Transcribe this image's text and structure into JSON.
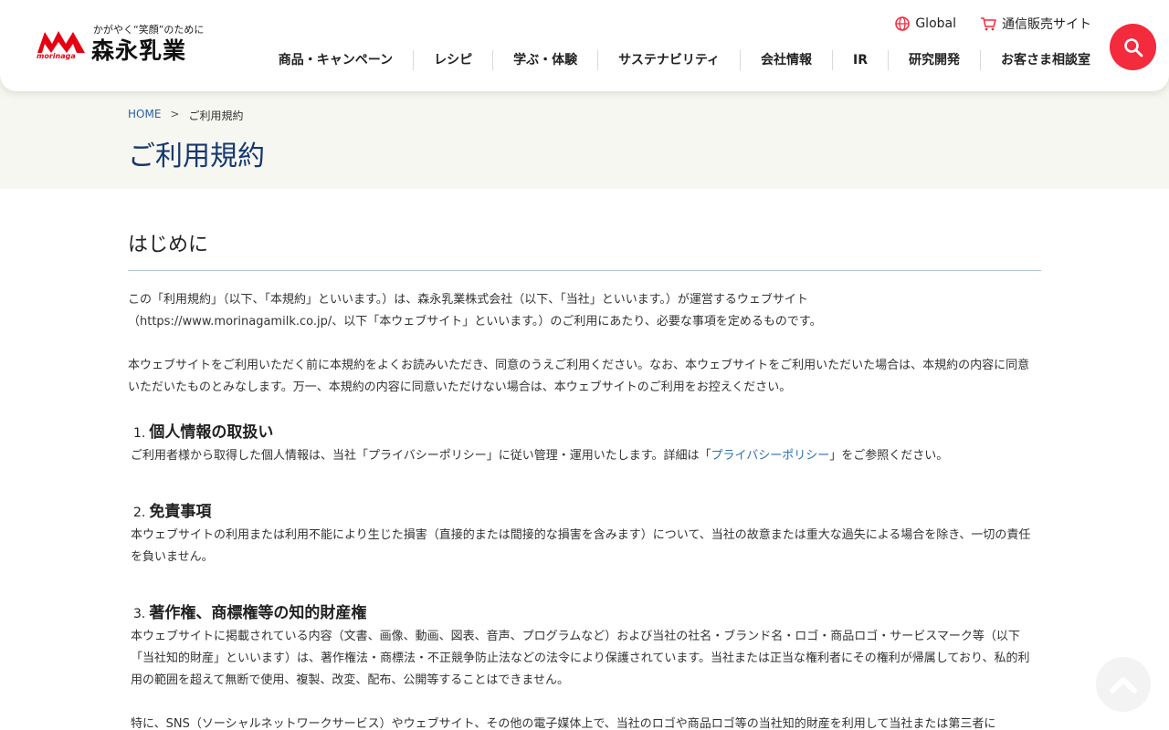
{
  "header": {
    "logo": {
      "tagline": "かがやく“笑顔”のために",
      "company": "森永乳業",
      "brandword": "morinaga",
      "brand_color": "#e60012"
    },
    "utility": {
      "global_label": "Global",
      "global_icon": "globe-icon",
      "shop_label": "通信販売サイト",
      "shop_icon": "cart-icon"
    },
    "nav": [
      {
        "label": "商品・キャンペーン"
      },
      {
        "label": "レシピ"
      },
      {
        "label": "学ぶ・体験"
      },
      {
        "label": "サステナビリティ"
      },
      {
        "label": "会社情報"
      },
      {
        "label": "IR"
      },
      {
        "label": "研究開発"
      },
      {
        "label": "お客さま相談室"
      }
    ],
    "search_icon": "search-icon",
    "accent_color": "#f42a3d"
  },
  "breadcrumb": {
    "home": "HOME",
    "separator": ">",
    "current": "ご利用規約"
  },
  "page_title": "ご利用規約",
  "content": {
    "intro_heading": "はじめに",
    "intro_p1_line1": "この「利用規約」（以下、「本規約」といいます。）は、森永乳業株式会社（以下、「当社」といいます。）が運営するウェブサイト",
    "intro_p1_line2": "（https://www.morinagamilk.co.jp/、以下「本ウェブサイト」といいます。）のご利用にあたり、必要な事項を定めるものです。",
    "intro_p2": "本ウェブサイトをご利用いただく前に本規約をよくお読みいただき、同意のうえご利用ください。なお、本ウェブサイトをご利用いただいた場合は、本規約の内容に同意いただいたものとみなします。万一、本規約の内容に同意いただけない場合は、本ウェブサイトのご利用をお控えください。",
    "s1_num": "1.",
    "s1_title": "個人情報の取扱い",
    "s1_text_before": "ご利用者様から取得した個人情報は、当社「プライバシーポリシー」に従い管理・運用いたします。詳細は「",
    "s1_link": "プライバシーポリシー",
    "s1_text_after": "」をご参照ください。",
    "s2_num": "2.",
    "s2_title": "免責事項",
    "s2_text": "本ウェブサイトの利用または利用不能により生じた損害（直接的または間接的な損害を含みます）について、当社の故意または重大な過失による場合を除き、一切の責任を負いません。",
    "s3_num": "3.",
    "s3_title": "著作権、商標権等の知的財産権",
    "s3_text": "本ウェブサイトに掲載されている内容（文書、画像、動画、図表、音声、プログラムなど）および当社の社名・ブランド名・ロゴ・商品ロゴ・サービスマーク等（以下「当社知的財産」といいます）は、著作権法・商標法・不正競争防止法などの法令により保護されています。当社または正当な権利者にその権利が帰属しており、私的利用の範囲を超えて無断で使用、複製、改変、配布、公開等することはできません。",
    "s3_text2": "特に、SNS（ソーシャルネットワークサービス）やウェブサイト、その他の電子媒体上で、当社のロゴや商品ロゴ等の当社知的財産を利用して当社または第三者に"
  },
  "back_to_top_icon": "chevron-up-icon"
}
